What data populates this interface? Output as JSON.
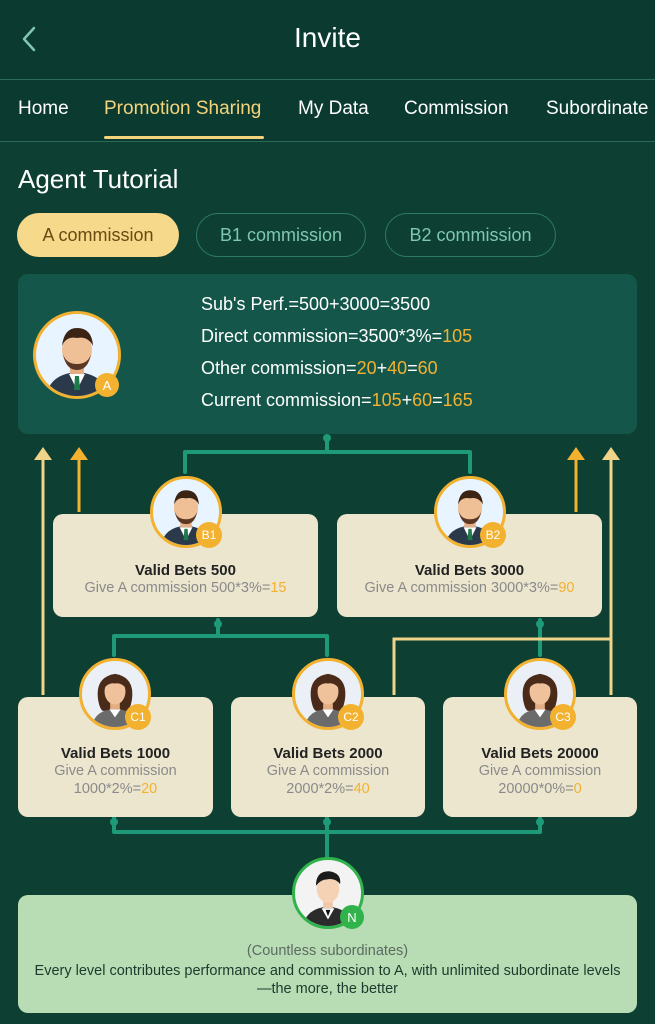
{
  "header": {
    "title": "Invite"
  },
  "tabs": [
    {
      "label": "Home"
    },
    {
      "label": "Promotion Sharing"
    },
    {
      "label": "My Data"
    },
    {
      "label": "Commission"
    },
    {
      "label": "Subordinate"
    }
  ],
  "section_title": "Agent Tutorial",
  "pills": [
    {
      "label": "A commission"
    },
    {
      "label": "B1 commission"
    },
    {
      "label": "B2 commission"
    }
  ],
  "summary": {
    "perf": "Sub's Perf.=500+3000=3500",
    "direct_prefix": "Direct commission=3500*3%=",
    "direct_value": "105",
    "other_prefix": "Other commission=",
    "other_a": "20",
    "other_plus": "+",
    "other_b": "40",
    "other_eq": "=",
    "other_value": "60",
    "current_prefix": "Current commission=",
    "current_a": "105",
    "current_plus": "+",
    "current_b": "60",
    "current_eq": "=",
    "current_value": "165"
  },
  "badges": {
    "a": "A",
    "b1": "B1",
    "b2": "B2",
    "c1": "C1",
    "c2": "C2",
    "c3": "C3",
    "n": "N"
  },
  "cards": {
    "b1": {
      "bets": "Valid Bets 500",
      "give": "Give A commission 500*3%=",
      "value": "15"
    },
    "b2": {
      "bets": "Valid Bets 3000",
      "give": "Give A commission 3000*3%=",
      "value": "90"
    },
    "c1": {
      "bets": "Valid Bets 1000",
      "give1": "Give A commission",
      "give2": "1000*2%=",
      "value": "20"
    },
    "c2": {
      "bets": "Valid Bets 2000",
      "give1": "Give A commission",
      "give2": "2000*2%=",
      "value": "40"
    },
    "c3": {
      "bets": "Valid Bets 20000",
      "give1": "Give A commission",
      "give2": "20000*0%=",
      "value": "0"
    }
  },
  "bottom": {
    "note": "(Countless subordinates)",
    "desc": "Every level contributes performance and commission to A, with unlimited subordinate levels—the more, the better"
  },
  "colors": {
    "background": "#0d3f33",
    "accent": "#f3b130",
    "active_tab": "#f5d37a",
    "line": "#1e9a78"
  },
  "icons": {
    "back": "chevron-left-icon",
    "avatar_male": "male-avatar-icon",
    "avatar_female": "female-avatar-icon",
    "arrow_up": "arrow-up-icon"
  }
}
